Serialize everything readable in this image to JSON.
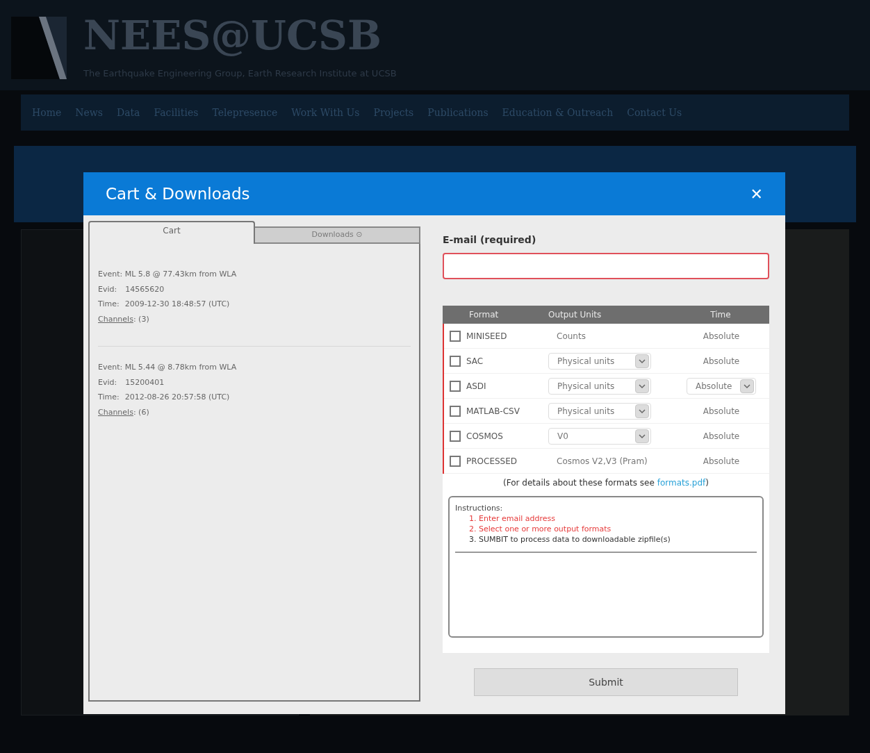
{
  "site": {
    "title": "NEES@UCSB",
    "tagline": "The Earthquake Engineering Group, Earth Research Institute at UCSB"
  },
  "nav": [
    "Home",
    "News",
    "Data",
    "Facilities",
    "Telepresence",
    "Work With Us",
    "Projects",
    "Publications",
    "Education & Outreach",
    "Contact Us"
  ],
  "dialog": {
    "title": "Cart & Downloads",
    "close": "✕",
    "tabs": [
      {
        "label": "Cart",
        "selected": true
      },
      {
        "label": "Downloads ⊙",
        "selected": false
      }
    ],
    "cart": [
      {
        "event": "Event: ML 5.8 @ 77.43km from WLA",
        "evid_label": "Evid:",
        "evid": "14565620",
        "time_label": "Time:",
        "time": "2009-12-30 18:48:57 (UTC)",
        "channels_link": "Channels",
        "channels_count": ": (3)"
      },
      {
        "event": "Event: ML 5.44 @ 8.78km from WLA",
        "evid_label": "Evid:",
        "evid": "15200401",
        "time_label": "Time:",
        "time": "2012-08-26 20:57:58 (UTC)",
        "channels_link": "Channels",
        "channels_count": ": (6)"
      }
    ],
    "email_label": "E-mail (required)",
    "columns": [
      "Format",
      "Output Units",
      "Time"
    ],
    "formats": [
      {
        "name": "MINISEED",
        "checked": false,
        "units": {
          "kind": "text",
          "value": "Counts"
        },
        "time": {
          "kind": "text",
          "value": "Absolute"
        }
      },
      {
        "name": "SAC",
        "checked": false,
        "units": {
          "kind": "select",
          "value": "Physical units"
        },
        "time": {
          "kind": "text",
          "value": "Absolute"
        }
      },
      {
        "name": "ASDI",
        "checked": false,
        "units": {
          "kind": "select",
          "value": "Physical units"
        },
        "time": {
          "kind": "select",
          "value": "Absolute"
        }
      },
      {
        "name": "MATLAB-CSV",
        "checked": false,
        "units": {
          "kind": "select",
          "value": "Physical units"
        },
        "time": {
          "kind": "text",
          "value": "Absolute"
        }
      },
      {
        "name": "COSMOS",
        "checked": false,
        "units": {
          "kind": "select",
          "value": "V0"
        },
        "time": {
          "kind": "text",
          "value": "Absolute"
        }
      },
      {
        "name": "PROCESSED",
        "checked": false,
        "units": {
          "kind": "text",
          "value": "Cosmos V2,V3 (Pram)"
        },
        "time": {
          "kind": "text",
          "value": "Absolute"
        }
      }
    ],
    "details_note": "(For details about these formats see ",
    "details_link": "formats.pdf",
    "details_end": ")",
    "instructions_title": "Instructions:",
    "instructions": [
      {
        "text": "1. Enter email address",
        "done": false
      },
      {
        "text": "2. Select one or more output formats",
        "done": false
      },
      {
        "text": "3. SUMBIT to process data to downloadable zipfile(s)",
        "done": true
      }
    ],
    "submit": "Submit"
  }
}
